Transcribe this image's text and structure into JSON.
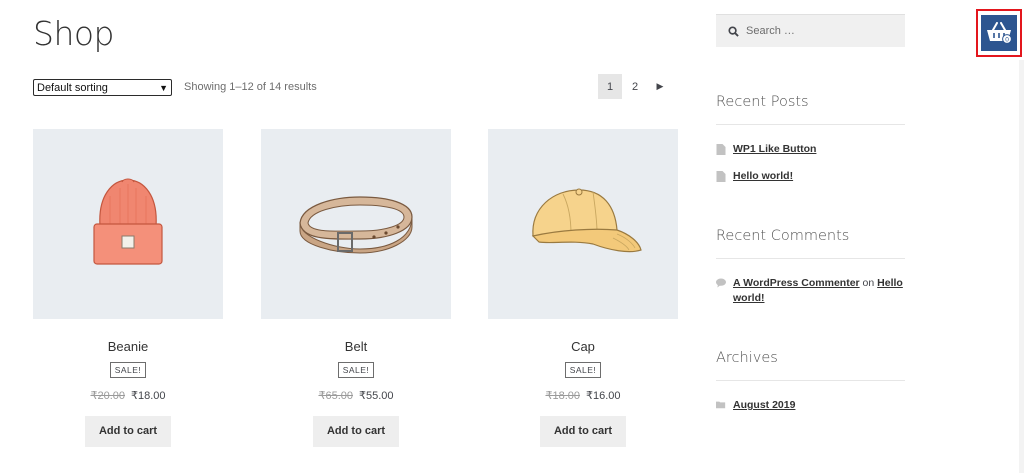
{
  "page": {
    "title": "Shop"
  },
  "toolbar": {
    "sort_selected": "Default sorting",
    "result_count": "Showing 1–12 of 14 results"
  },
  "pagination": {
    "pages": [
      "1",
      "2"
    ],
    "current": "1",
    "next_icon": "triangle-right-icon"
  },
  "products": [
    {
      "name": "Beanie",
      "badge": "SALE!",
      "old_price": "₹20.00",
      "price": "₹18.00",
      "button": "Add to cart"
    },
    {
      "name": "Belt",
      "badge": "SALE!",
      "old_price": "₹65.00",
      "price": "₹55.00",
      "button": "Add to cart"
    },
    {
      "name": "Cap",
      "badge": "SALE!",
      "old_price": "₹18.00",
      "price": "₹16.00",
      "button": "Add to cart"
    }
  ],
  "sidebar": {
    "search_placeholder": "Search …",
    "recent_posts": {
      "title": "Recent Posts",
      "items": [
        "WP1 Like Button",
        "Hello world!"
      ]
    },
    "recent_comments": {
      "title": "Recent Comments",
      "author": "A WordPress Commenter",
      "on": "on",
      "post": "Hello world!"
    },
    "archives": {
      "title": "Archives",
      "items": [
        "August 2019"
      ]
    }
  },
  "cart": {
    "icon": "basket-icon",
    "count": "0",
    "bg_color": "#2d5590",
    "highlight_color": "#e3161d"
  }
}
